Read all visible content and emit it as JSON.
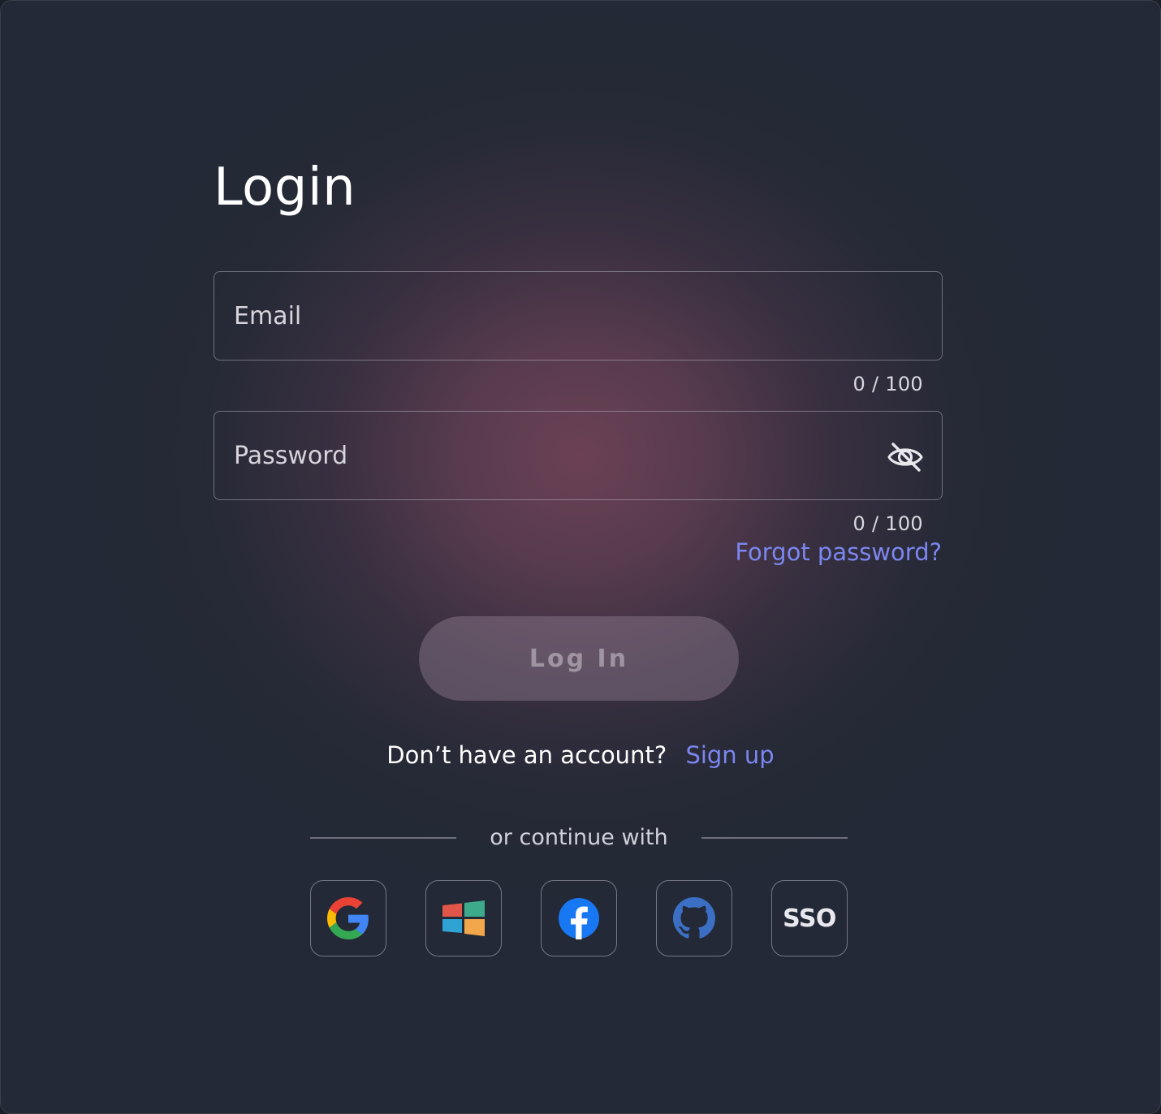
{
  "page": {
    "title": "Login"
  },
  "email": {
    "placeholder": "Email",
    "value": "",
    "counter": "0 / 100"
  },
  "password": {
    "placeholder": "Password",
    "value": "",
    "counter": "0 / 100",
    "toggle_icon": "eye-off-icon"
  },
  "forgot_password": "Forgot password?",
  "login_button": "Log In",
  "signup": {
    "prompt": "Don’t have an account?",
    "link": "Sign up"
  },
  "divider_text": "or continue with",
  "social": [
    {
      "icon": "google-icon"
    },
    {
      "icon": "windows-icon"
    },
    {
      "icon": "facebook-icon"
    },
    {
      "icon": "github-icon"
    },
    {
      "label": "SSO"
    }
  ],
  "colors": {
    "background": "#232936",
    "accent": "#7b86f0",
    "glow": "#704256",
    "button": "#6f5f6e"
  }
}
